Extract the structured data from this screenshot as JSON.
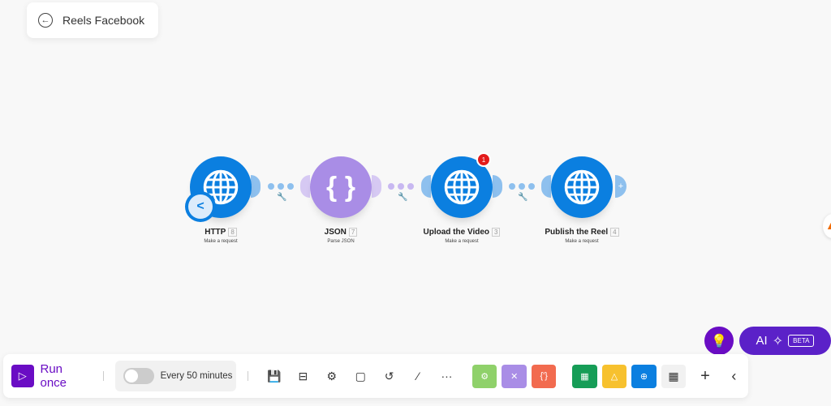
{
  "scenario": {
    "title": "Reels Facebook",
    "back_icon": "arrow-left-icon"
  },
  "modules": [
    {
      "name": "HTTP",
      "id": "8",
      "subtitle": "Make a request",
      "icon": "globe-icon",
      "color": "#0b7fe0"
    },
    {
      "name": "JSON",
      "id": "7",
      "subtitle": "Parse JSON",
      "icon": "braces-icon",
      "color": "#a98de6"
    },
    {
      "name": "Upload the Video",
      "id": "3",
      "subtitle": "Make a request",
      "icon": "globe-icon",
      "color": "#0b7fe0",
      "badge": "1"
    },
    {
      "name": "Publish the Reel",
      "id": "4",
      "subtitle": "Make a request",
      "icon": "globe-icon",
      "color": "#0b7fe0"
    }
  ],
  "toolbar": {
    "run_label": "Run once",
    "schedule_label": "Every 50 minutes",
    "schedule_enabled": false
  },
  "ai": {
    "label": "AI",
    "beta": "BETA"
  },
  "colors": {
    "accent": "#6a0dc4",
    "brand_blue": "#0b7fe0"
  }
}
